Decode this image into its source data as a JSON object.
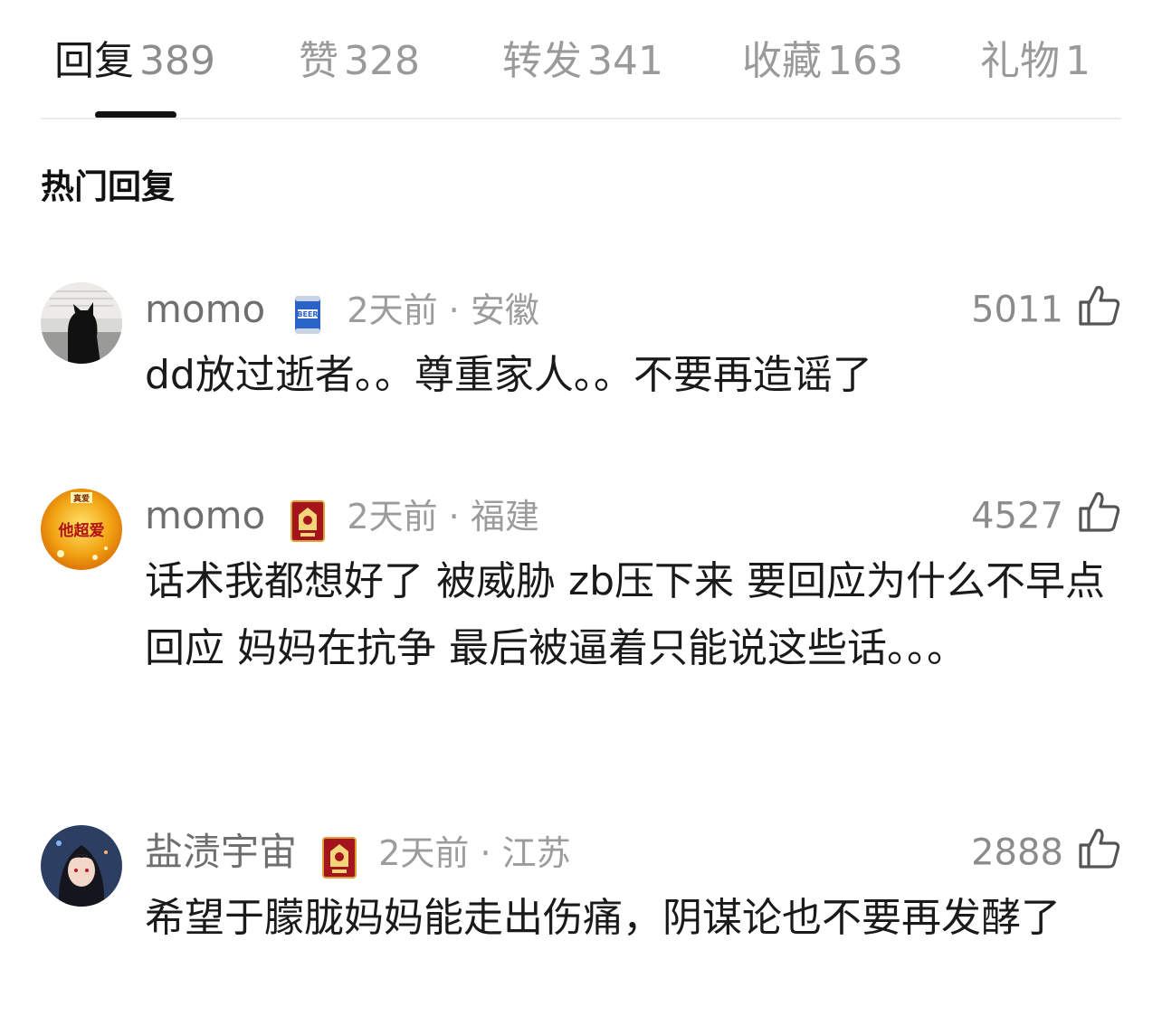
{
  "tabs": [
    {
      "label": "回复",
      "count": "389"
    },
    {
      "label": "赞",
      "count": "328"
    },
    {
      "label": "转发",
      "count": "341"
    },
    {
      "label": "收藏",
      "count": "163"
    },
    {
      "label": "礼物",
      "count": "1"
    }
  ],
  "section_title": "热门回复",
  "comments": [
    {
      "username": "momo",
      "badge_icon": "beer-can-badge-icon",
      "meta": "2天前 · 安徽",
      "likes": "5011",
      "text": "dd放过逝者。。尊重家人。。不要再造谣了"
    },
    {
      "username": "momo",
      "badge_icon": "red-envelope-badge-icon",
      "meta": "2天前 · 福建",
      "likes": "4527",
      "text": "话术我都想好了 被威胁 zb压下来 要回应为什么不早点回应 妈妈在抗争 最后被逼着只能说这些话。。。",
      "avatar_text_top": "真爱",
      "avatar_text_main": "他超爱"
    },
    {
      "username": "盐渍宇宙",
      "badge_icon": "red-envelope-badge-icon",
      "meta": "2天前 · 江苏",
      "likes": "2888",
      "text": "希望于朦胧妈妈能走出伤痛，阴谋论也不要再发酵了"
    }
  ],
  "colors": {
    "active_tab": "#1a1a1a",
    "inactive_tab": "#9a9a9a",
    "accent_red": "#b3121b"
  }
}
